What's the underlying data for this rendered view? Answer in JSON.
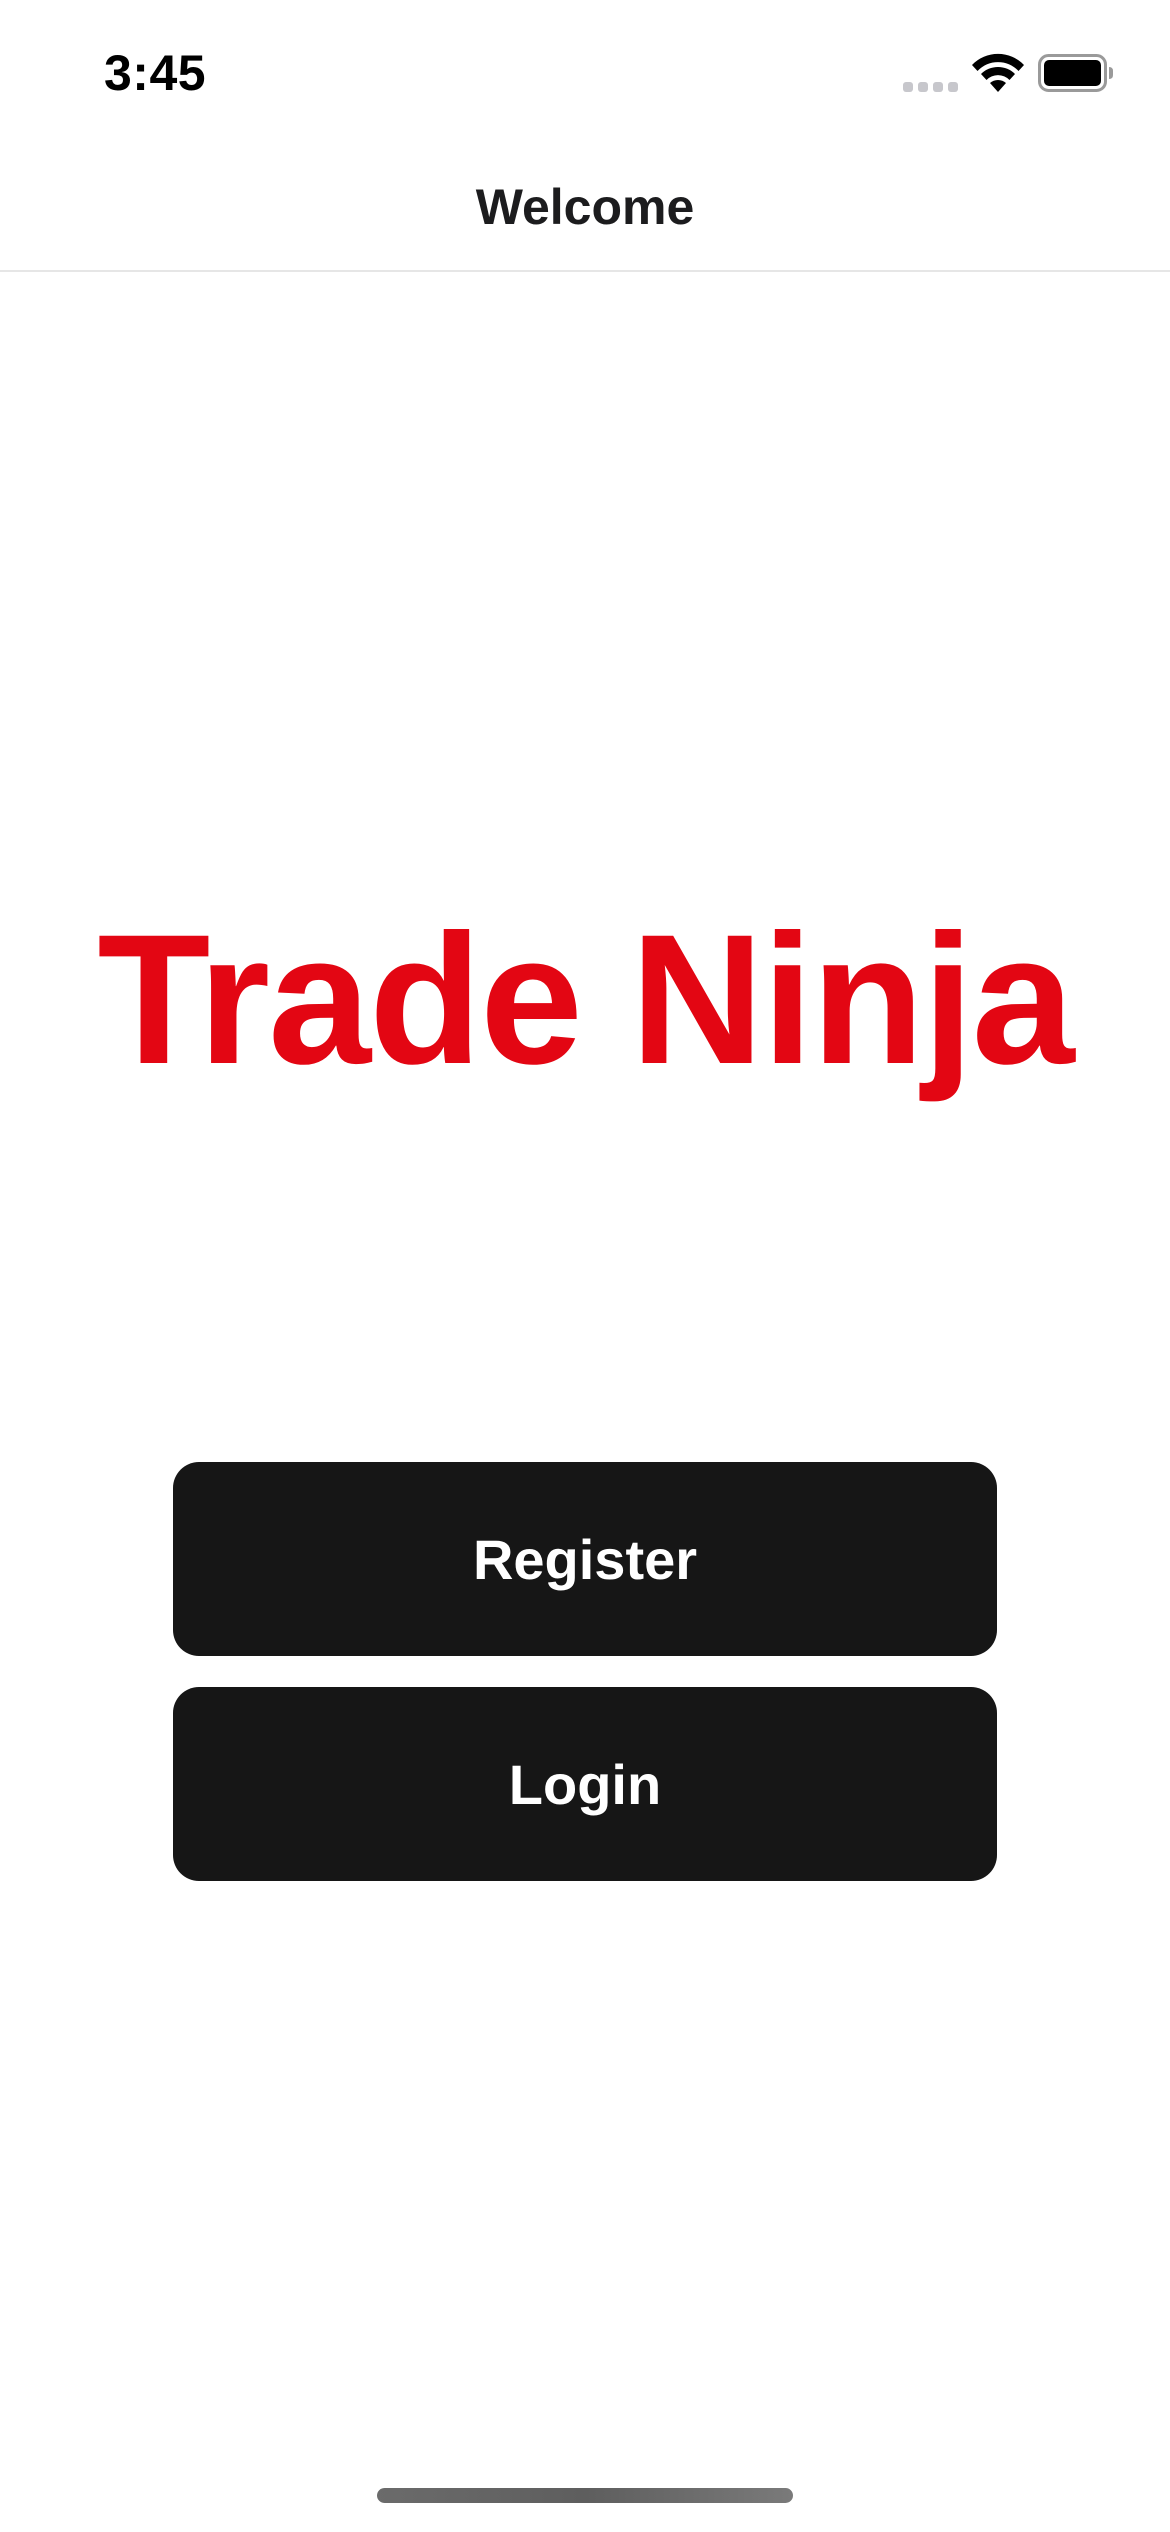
{
  "status_bar": {
    "time": "3:45",
    "signal_icon": "cellular-signal-icon",
    "wifi_icon": "wifi-icon",
    "battery_icon": "battery-icon"
  },
  "nav": {
    "title": "Welcome"
  },
  "brand": {
    "title": "Trade Ninja",
    "color": "#e30613"
  },
  "actions": {
    "register_label": "Register",
    "login_label": "Login",
    "button_color": "#161616"
  }
}
